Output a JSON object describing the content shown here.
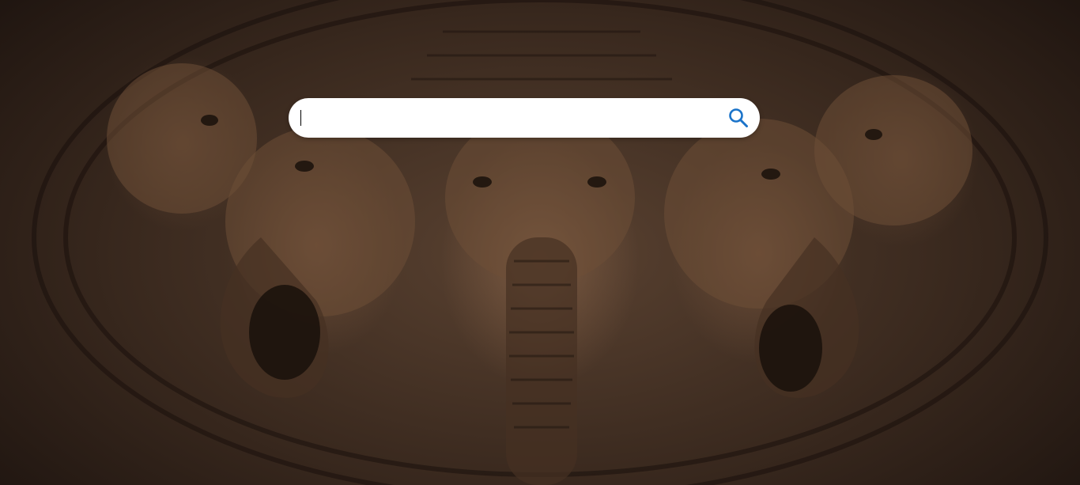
{
  "background": {
    "description_icon": "ganesha-wood-carving-image"
  },
  "search": {
    "value": "",
    "placeholder": "",
    "icon": "search-icon",
    "icon_color": "#1a73c9"
  }
}
